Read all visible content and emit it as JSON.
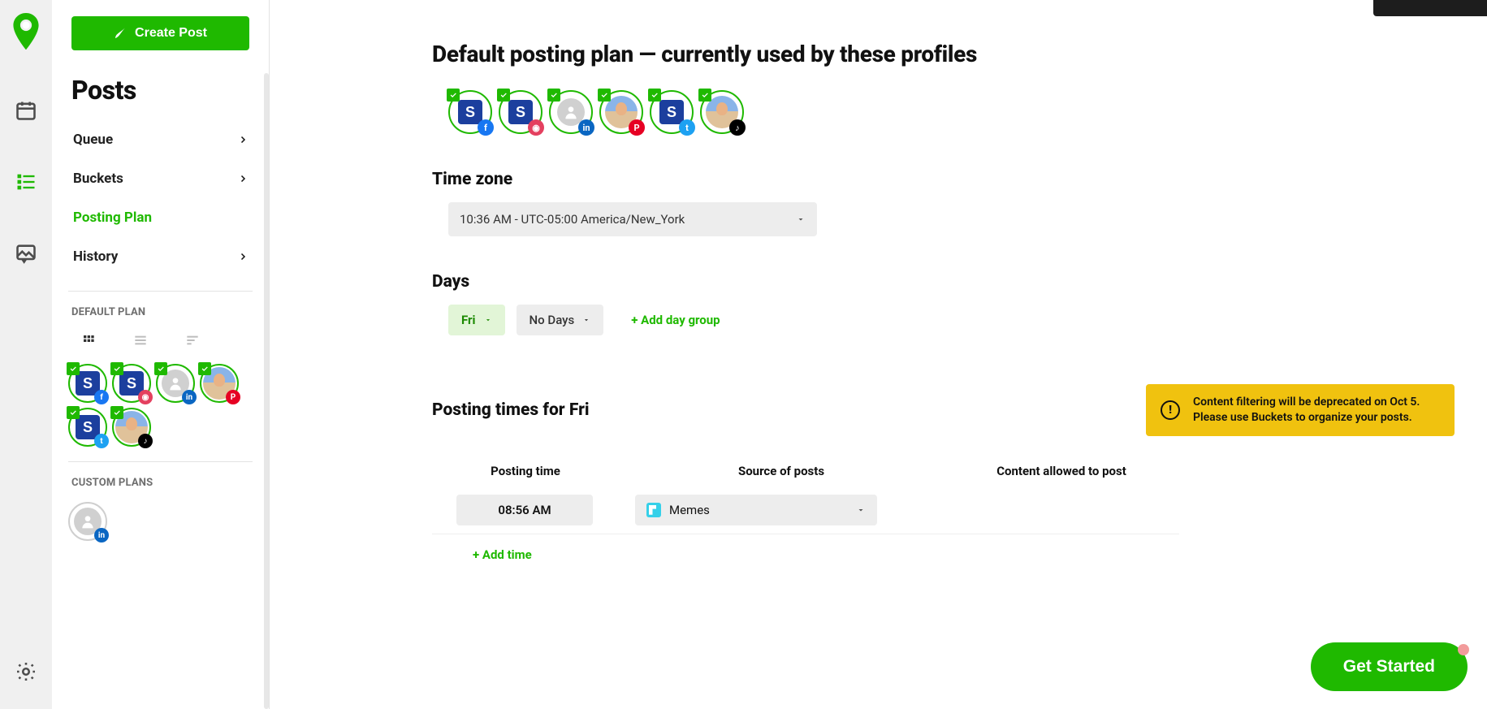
{
  "create_post_label": "Create Post",
  "sidebar_title": "Posts",
  "side_nav": {
    "queue": "Queue",
    "buckets": "Buckets",
    "posting_plan": "Posting Plan",
    "history": "History"
  },
  "default_plan_label": "DEFAULT PLAN",
  "custom_plans_label": "CUSTOM PLANS",
  "profiles": [
    {
      "type": "logo",
      "network": "fb"
    },
    {
      "type": "logo",
      "network": "ig"
    },
    {
      "type": "placeholder",
      "network": "li"
    },
    {
      "type": "photo",
      "network": "pt"
    },
    {
      "type": "logo",
      "network": "tw"
    },
    {
      "type": "photo",
      "network": "tt"
    }
  ],
  "custom_profiles": [
    {
      "type": "placeholder",
      "network": "li",
      "ring": "gray",
      "no_check": true
    }
  ],
  "main": {
    "heading": "Default posting plan — currently used by these profiles",
    "timezone_title": "Time zone",
    "timezone_value": "10:36 AM - UTC-05:00 America/New_York",
    "days_title": "Days",
    "day_selected": "Fri",
    "no_days": "No Days",
    "add_day_group": "+ Add day group",
    "posting_times_title": "Posting times for Fri",
    "warning": "Content filtering will be deprecated on Oct 5. Please use Buckets to organize your posts.",
    "table_headers": {
      "posting_time": "Posting time",
      "source": "Source of posts",
      "allowed": "Content allowed to post"
    },
    "rows": [
      {
        "time": "08:56 AM",
        "source": "Memes"
      }
    ],
    "add_time": "+ Add time"
  },
  "get_started_label": "Get Started"
}
